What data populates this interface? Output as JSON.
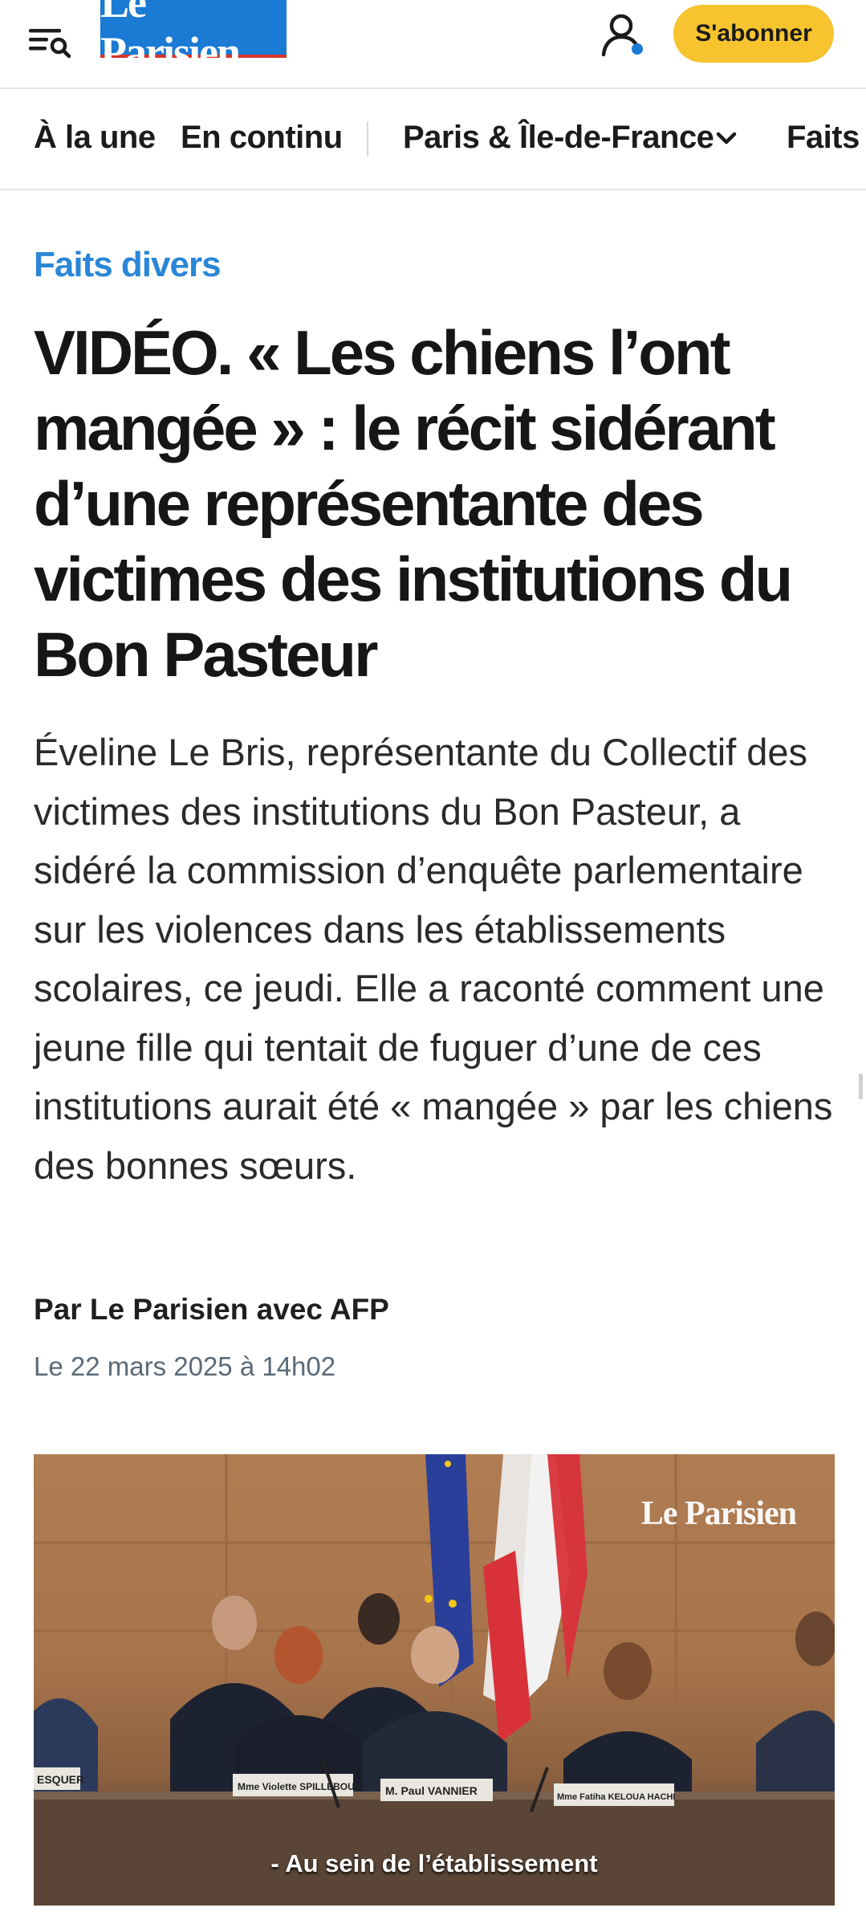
{
  "header": {
    "logo_text": "Le Parisien",
    "subscribe_label": "S'abonner",
    "menu_icon": "menu-search-icon",
    "account_icon": "user-icon"
  },
  "nav": {
    "items": [
      "À la une",
      "En continu",
      "Paris & Île-de-France",
      "Faits divers"
    ]
  },
  "article": {
    "category": "Faits divers",
    "headline": "VIDÉO. « Les chiens l’ont mangée » : le récit sidérant d’une représentante des victimes des institutions du Bon Pasteur",
    "lede": "Éveline Le Bris, représentante du Collectif des victimes des institutions du Bon Pasteur, a sidéré la commission d’enquête parlementaire sur les violences dans les établissements scolaires, ce jeudi. Elle a raconté comment une jeune fille qui tentait de fuguer d’une de ces institutions aurait été « mangée » par les chiens des bonnes sœurs.",
    "byline": "Par Le Parisien avec AFP",
    "date": "Le 22 mars 2025 à 14h02"
  },
  "video": {
    "watermark": "Le Parisien",
    "caption": "- Au sein de l’établissement",
    "nameplates": [
      "ESQUER",
      "Mme Violette SPILLEBOUT",
      "M. Paul VANNIER",
      "Mme Fatiha KELOUA HACHI"
    ]
  },
  "colors": {
    "brand_blue": "#1a7ad4",
    "category_blue": "#2a86d7",
    "subscribe_yellow": "#f7c42f",
    "logo_underline_red": "#d9342b"
  }
}
